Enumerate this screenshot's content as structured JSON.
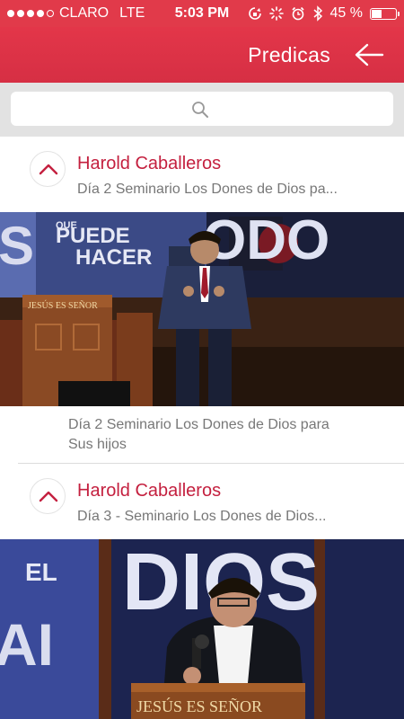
{
  "status": {
    "carrier": "CLARO",
    "network": "LTE",
    "time": "5:03 PM",
    "battery": "45 %",
    "battery_level": 0.45
  },
  "nav": {
    "title": "Predicas",
    "back_icon": "arrow-left-icon"
  },
  "search": {
    "icon": "search-icon"
  },
  "sermons": [
    {
      "author": "Harold Caballeros",
      "title_short": "Día 2 Seminario Los Dones de Dios pa...",
      "caption_line1": "Día 2 Seminario Los Dones de Dios para",
      "caption_line2": "Sus hijos",
      "banner_top": "QUE",
      "banner_line1": "PUEDE",
      "banner_line2": "HACER",
      "banner_letters": "ODO",
      "banner_side": "S",
      "pulpit": "JESÚS ES SEÑOR"
    },
    {
      "author": "Harold Caballeros",
      "title_short": "Día 3 - Seminario Los Dones de Dios...",
      "banner_el": "EL",
      "banner_dios": "DIOS",
      "banner_side": "AI",
      "pulpit": "JESÚS ES SEÑOR"
    }
  ],
  "colors": {
    "accent": "#e13a4a",
    "author": "#c4203f"
  }
}
